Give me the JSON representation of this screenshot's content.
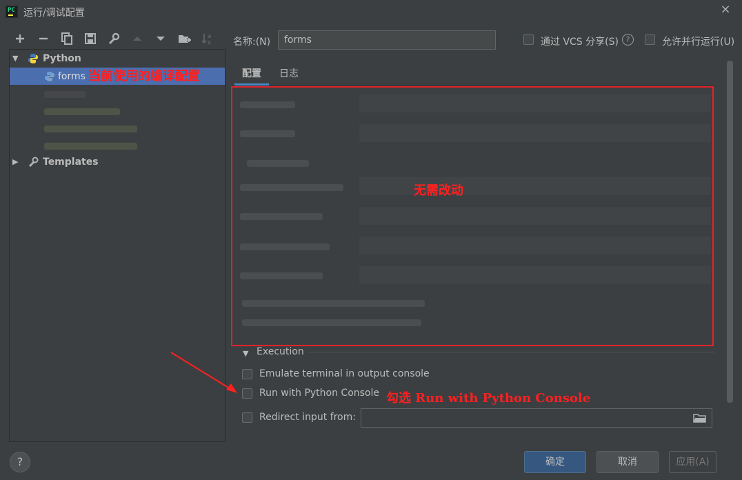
{
  "window": {
    "title": "运行/调试配置",
    "close_glyph": "×"
  },
  "toolbar": {
    "icons": [
      "add-icon",
      "remove-icon",
      "copy-icon",
      "save-icon",
      "wrench-icon",
      "move-up-icon",
      "move-down-icon",
      "new-folder-icon",
      "sort-icon"
    ]
  },
  "tree": {
    "python_label": "Python",
    "selected_item": "forms",
    "templates_label": "Templates"
  },
  "name": {
    "label": "名称:(N)",
    "value": "forms"
  },
  "options": {
    "share_vcs": "通过 VCS 分享(S)",
    "allow_parallel": "允许并行运行(U)"
  },
  "tabs": [
    {
      "label": "配置",
      "active": true
    },
    {
      "label": "日志",
      "active": false
    }
  ],
  "execution": {
    "title": "Execution",
    "emulate_terminal": "Emulate terminal in output console",
    "run_python_console": "Run with Python Console",
    "redirect_input": "Redirect input from:",
    "redirect_value": ""
  },
  "buttons": {
    "ok": "确定",
    "cancel": "取消",
    "apply": "应用(A)",
    "help": "?"
  },
  "annotations": {
    "current_config": "当前使用的编译配置",
    "no_change": "无需改动",
    "check_option": "勾选 Run with Python Console"
  },
  "colors": {
    "background": "#3c3f41",
    "selection": "#4b6eaf",
    "annotation_red": "#ff2020",
    "primary_button": "#365880"
  }
}
